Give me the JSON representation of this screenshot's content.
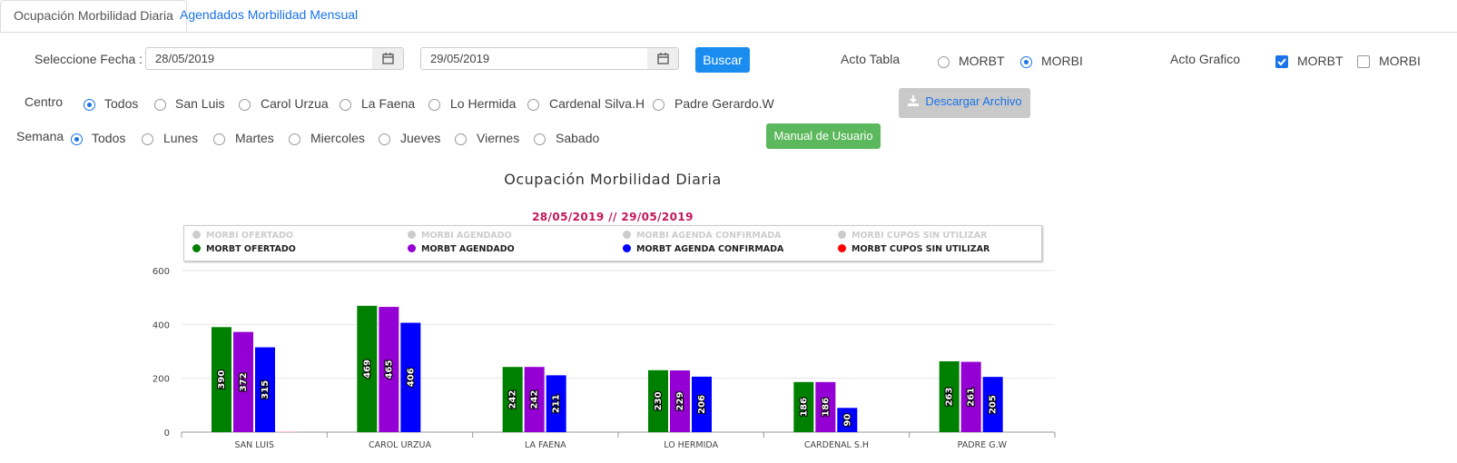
{
  "tabs": [
    {
      "label": "Ocupación Morbilidad Diaria",
      "active": true
    },
    {
      "label": "Agendados Morbilidad Mensual",
      "active": false
    }
  ],
  "filters": {
    "date_label": "Seleccione Fecha :",
    "date_from": "28/05/2019",
    "date_to": "29/05/2019",
    "search_button": "Buscar",
    "acto_tabla_label": "Acto Tabla",
    "acto_tabla_options": [
      {
        "label": "MORBT",
        "selected": false
      },
      {
        "label": "MORBI",
        "selected": true
      }
    ],
    "acto_grafico_label": "Acto Grafico",
    "acto_grafico_options": [
      {
        "label": "MORBT",
        "checked": true
      },
      {
        "label": "MORBI",
        "checked": false
      }
    ],
    "centro_label": "Centro",
    "centro_options": [
      {
        "label": "Todos",
        "selected": true
      },
      {
        "label": "San Luis",
        "selected": false
      },
      {
        "label": "Carol Urzua",
        "selected": false
      },
      {
        "label": "La Faena",
        "selected": false
      },
      {
        "label": "Lo Hermida",
        "selected": false
      },
      {
        "label": "Cardenal Silva.H",
        "selected": false
      },
      {
        "label": "Padre Gerardo.W",
        "selected": false
      }
    ],
    "semana_label": "Semana",
    "semana_options": [
      {
        "label": "Todos",
        "selected": true
      },
      {
        "label": "Lunes",
        "selected": false
      },
      {
        "label": "Martes",
        "selected": false
      },
      {
        "label": "Miercoles",
        "selected": false
      },
      {
        "label": "Jueves",
        "selected": false
      },
      {
        "label": "Viernes",
        "selected": false
      },
      {
        "label": "Sabado",
        "selected": false
      }
    ],
    "download_button": "Descargar Archivo",
    "manual_button": "Manual de Usuario"
  },
  "icons": {
    "calendar": "calendar-icon",
    "download": "download-icon",
    "check": "check-icon"
  },
  "colors": {
    "accent": "#1a8cf0",
    "success": "#5cb85c",
    "subtitle": "#c2185b"
  },
  "chart_data": {
    "type": "bar",
    "title": "Ocupación Morbilidad Diaria",
    "subtitle": "28/05/2019 // 29/05/2019",
    "categories": [
      "SAN LUIS",
      "CAROL URZUA",
      "LA FAENA",
      "LO HERMIDA",
      "CARDENAL S.H",
      "PADRE G.W"
    ],
    "ylim": [
      0,
      600
    ],
    "yticks": [
      0,
      200,
      400,
      600
    ],
    "grid": true,
    "legend_position": "top",
    "legend_hidden": [
      {
        "name": "MORBI OFERTADO",
        "color": "#cccccc"
      },
      {
        "name": "MORBI AGENDADO",
        "color": "#cccccc"
      },
      {
        "name": "MORBI AGENDA CONFIRMADA",
        "color": "#cccccc"
      },
      {
        "name": "MORBI CUPOS SIN UTILIZAR",
        "color": "#cccccc"
      }
    ],
    "series": [
      {
        "name": "MORBT OFERTADO",
        "color": "#008000",
        "values": [
          390,
          469,
          242,
          230,
          186,
          263
        ]
      },
      {
        "name": "MORBT AGENDADO",
        "color": "#9400d3",
        "values": [
          372,
          465,
          242,
          229,
          186,
          261
        ]
      },
      {
        "name": "MORBT AGENDA CONFIRMADA",
        "color": "#0000ff",
        "values": [
          315,
          406,
          211,
          206,
          90,
          205
        ]
      },
      {
        "name": "MORBT CUPOS SIN UTILIZAR",
        "color": "#ff0000",
        "values": [
          3,
          0,
          0,
          0,
          0,
          0
        ]
      }
    ]
  }
}
